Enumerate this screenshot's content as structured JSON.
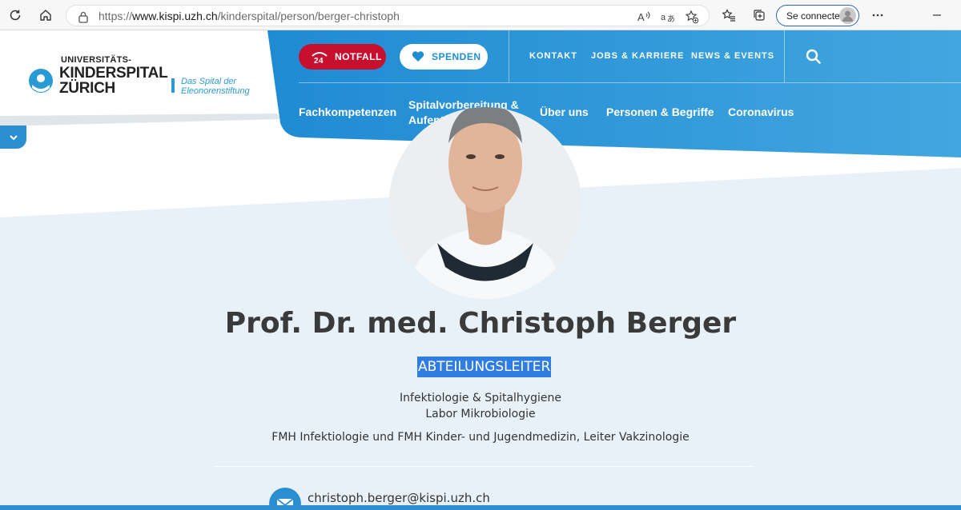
{
  "browser": {
    "url_prefix": "https://",
    "url_host": "www.kispi.uzh.ch",
    "url_path": "/kinderspital/person/berger-christoph",
    "connect_label": "Se connecter"
  },
  "logo": {
    "line1": "UNIVERSITÄTS-",
    "line2": "KINDERSPITAL",
    "line3": "ZÜRICH",
    "tagline1": "Das Spital der",
    "tagline2": "Eleonorenstiftung"
  },
  "header": {
    "notfall_label": "NOTFALL",
    "notfall_badge": "24",
    "spenden_label": "SPENDEN",
    "top_links": [
      "KONTAKT",
      "JOBS & KARRIERE",
      "NEWS & EVENTS"
    ],
    "main_nav": [
      "Fachkompetenzen",
      "Spitalvorbereitung &",
      "Aufenthalt",
      "Über uns",
      "Personen & Begriffe",
      "Coronavirus"
    ]
  },
  "profile": {
    "name": "Prof. Dr. med. Christoph Berger",
    "role": "ABTEILUNGSLEITER",
    "dept1": "Infektiologie & Spitalhygiene",
    "dept2": "Labor Mikrobiologie",
    "specialty": "FMH Infektiologie und FMH Kinder- und Jugendmedizin, Leiter Vakzinologie",
    "email": "christoph.berger@kispi.uzh.ch"
  },
  "colors": {
    "brand_blue": "#2a8fd0",
    "notfall_red": "#c8102e",
    "background": "#e8f1f7",
    "selection": "#2f7de1"
  },
  "icons": [
    "reload-icon",
    "home-icon",
    "lock-icon",
    "read-aloud-icon",
    "translate-icon",
    "add-favorite-icon",
    "favorites-icon",
    "collections-icon",
    "more-icon",
    "chevron-down-icon",
    "phone-24-icon",
    "heart-icon",
    "search-icon",
    "mail-icon"
  ]
}
